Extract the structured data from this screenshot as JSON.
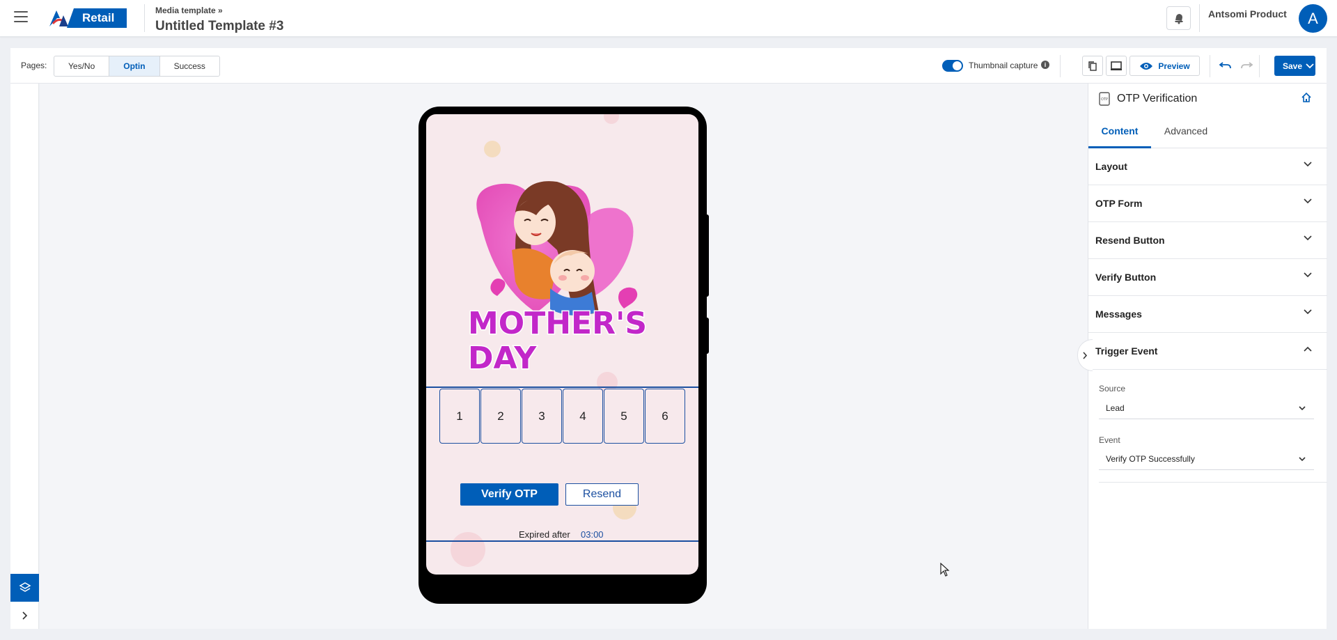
{
  "header": {
    "app_name": "Retail",
    "breadcrumb": "Media template »",
    "title": "Untitled Template #3",
    "account": "Antsomi Product",
    "avatar_initial": "A"
  },
  "toolbar": {
    "pages_label": "Pages:",
    "pages": [
      {
        "label": "Yes/No",
        "active": false
      },
      {
        "label": "Optin",
        "active": true
      },
      {
        "label": "Success",
        "active": false
      }
    ],
    "thumbnail_label": "Thumbnail capture",
    "thumbnail_enabled": true,
    "preview_label": "Preview",
    "save_label": "Save"
  },
  "canvas": {
    "otp_digits": [
      "1",
      "2",
      "3",
      "4",
      "5",
      "6"
    ],
    "verify_label": "Verify OTP",
    "resend_label": "Resend",
    "expired_label": "Expired after",
    "countdown": "03:00",
    "artwork_line1": "MOTHER'S",
    "artwork_line2": "DAY"
  },
  "panel": {
    "title": "OTP Verification",
    "tabs": [
      {
        "label": "Content",
        "active": true
      },
      {
        "label": "Advanced",
        "active": false
      }
    ],
    "sections": [
      {
        "label": "Layout",
        "expanded": false
      },
      {
        "label": "OTP Form",
        "expanded": false
      },
      {
        "label": "Resend Button",
        "expanded": false
      },
      {
        "label": "Verify Button",
        "expanded": false
      },
      {
        "label": "Messages",
        "expanded": false
      },
      {
        "label": "Trigger Event",
        "expanded": true
      }
    ],
    "trigger": {
      "source_label": "Source",
      "source_value": "Lead",
      "event_label": "Event",
      "event_value": "Verify OTP Successfully"
    }
  },
  "colors": {
    "accent": "#005eb8",
    "otp_border": "#1b4fa0",
    "screen_bg": "#f7e9ec",
    "artwork_text": "#c227c9"
  },
  "icons": [
    "hamburger-icon",
    "logo-icon",
    "bell-icon",
    "info-icon",
    "copy-icon",
    "desktop-icon",
    "eye-icon",
    "undo-icon",
    "redo-icon",
    "chevron-down-icon",
    "layers-icon",
    "chevron-right-icon",
    "otp-icon",
    "home-icon",
    "mouse-cursor-icon"
  ]
}
